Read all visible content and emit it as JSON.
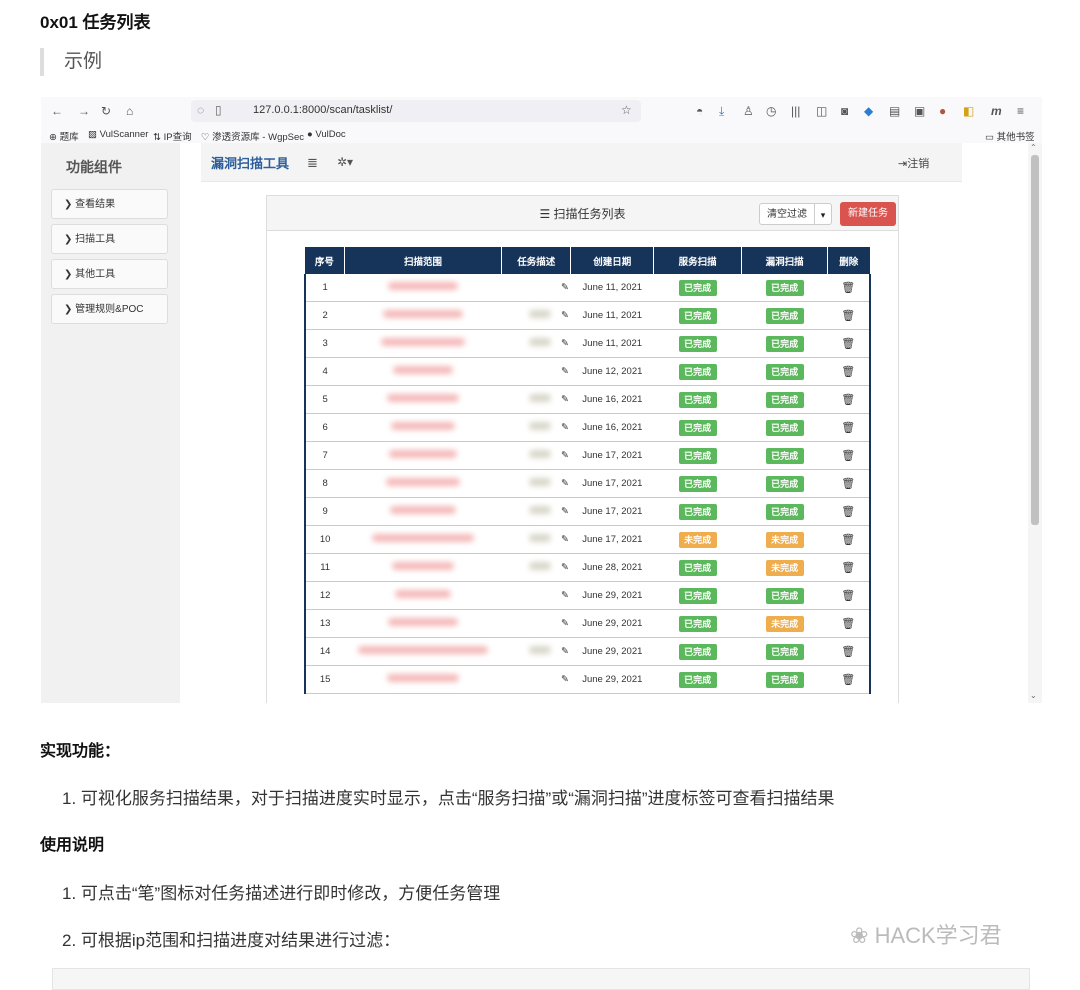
{
  "heading": "0x01 任务列表",
  "quote": "示例",
  "browser": {
    "url": "127.0.0.1:8000/scan/tasklist/",
    "bookmarks": [
      "题库",
      "VulScanner",
      "IP查询",
      "渗透资源库 - WgpSec",
      "VulDoc"
    ],
    "other_bookmarks": "其他书签"
  },
  "sidebar": {
    "title": "功能组件",
    "items": [
      "查看结果",
      "扫描工具",
      "其他工具",
      "管理规则&POC"
    ]
  },
  "topnav": {
    "brand": "漏洞扫描工具",
    "logout": "注销"
  },
  "panel": {
    "title": "扫描任务列表",
    "clear_filter": "清空过滤",
    "new_task": "新建任务"
  },
  "table": {
    "headers": [
      "序号",
      "扫描范围",
      "任务描述",
      "创建日期",
      "服务扫描",
      "漏洞扫描",
      "删除"
    ],
    "rows": [
      {
        "id": "1",
        "date": "June 11, 2021",
        "service": "已完成",
        "vuln": "已完成"
      },
      {
        "id": "2",
        "date": "June 11, 2021",
        "service": "已完成",
        "vuln": "已完成"
      },
      {
        "id": "3",
        "date": "June 11, 2021",
        "service": "已完成",
        "vuln": "已完成"
      },
      {
        "id": "4",
        "date": "June 12, 2021",
        "service": "已完成",
        "vuln": "已完成"
      },
      {
        "id": "5",
        "date": "June 16, 2021",
        "service": "已完成",
        "vuln": "已完成"
      },
      {
        "id": "6",
        "date": "June 16, 2021",
        "service": "已完成",
        "vuln": "已完成"
      },
      {
        "id": "7",
        "date": "June 17, 2021",
        "service": "已完成",
        "vuln": "已完成"
      },
      {
        "id": "8",
        "date": "June 17, 2021",
        "service": "已完成",
        "vuln": "已完成"
      },
      {
        "id": "9",
        "date": "June 17, 2021",
        "service": "已完成",
        "vuln": "已完成"
      },
      {
        "id": "10",
        "date": "June 17, 2021",
        "service": "未完成",
        "vuln": "未完成"
      },
      {
        "id": "11",
        "date": "June 28, 2021",
        "service": "已完成",
        "vuln": "未完成"
      },
      {
        "id": "12",
        "date": "June 29, 2021",
        "service": "已完成",
        "vuln": "已完成"
      },
      {
        "id": "13",
        "date": "June 29, 2021",
        "service": "已完成",
        "vuln": "未完成"
      },
      {
        "id": "14",
        "date": "June 29, 2021",
        "service": "已完成",
        "vuln": "已完成"
      },
      {
        "id": "15",
        "date": "June 29, 2021",
        "service": "已完成",
        "vuln": "已完成"
      }
    ]
  },
  "article": {
    "features_title": "实现功能：",
    "features": [
      "1. 可视化服务扫描结果，对于扫描进度实时显示，点击“服务扫描”或“漏洞扫描”进度标签可查看扫描结果"
    ],
    "usage_title": "使用说明",
    "usage": [
      "1. 可点击“笔”图标对任务描述进行即时修改，方便任务管理",
      "2. 可根据ip范围和扫描进度对结果进行过滤："
    ]
  },
  "watermark": "HACK学习君",
  "colors": {
    "done": "#5cb85c",
    "todo": "#f0ad4e",
    "header": "#163459",
    "danger": "#d9534f",
    "brand": "#2e5f9a"
  }
}
